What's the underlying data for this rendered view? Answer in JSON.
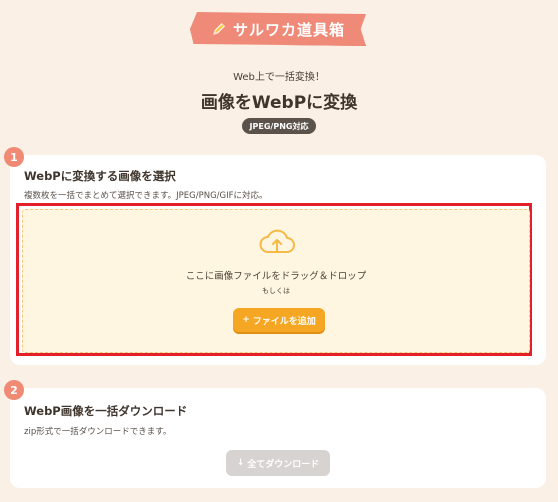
{
  "header": {
    "logo_text": "サルワカ道具箱",
    "subtitle": "Web上で一括変換！",
    "title": "画像をWebPに変換",
    "badge": "JPEG/PNG対応"
  },
  "step1": {
    "number": "1",
    "title": "WebPに変換する画像を選択",
    "description": "複数枚を一括でまとめて選択できます。JPEG/PNG/GIFに対応。",
    "dropzone_text": "ここに画像ファイルをドラッグ＆ドロップ",
    "or_text": "もしくは",
    "add_button_icon": "+",
    "add_button_label": "ファイルを追加"
  },
  "step2": {
    "number": "2",
    "title": "WebP画像を一括ダウンロード",
    "description": "zip形式で一括ダウンロードできます。",
    "download_button_icon": "↓",
    "download_button_label": "全てダウンロード"
  },
  "colors": {
    "background": "#faf0e6",
    "accent_orange": "#f5a623",
    "step_badge": "#f08a74",
    "highlight_border": "#e3202a",
    "dropzone_bg": "#fff6e2",
    "disabled_button": "#d6d3d0"
  }
}
